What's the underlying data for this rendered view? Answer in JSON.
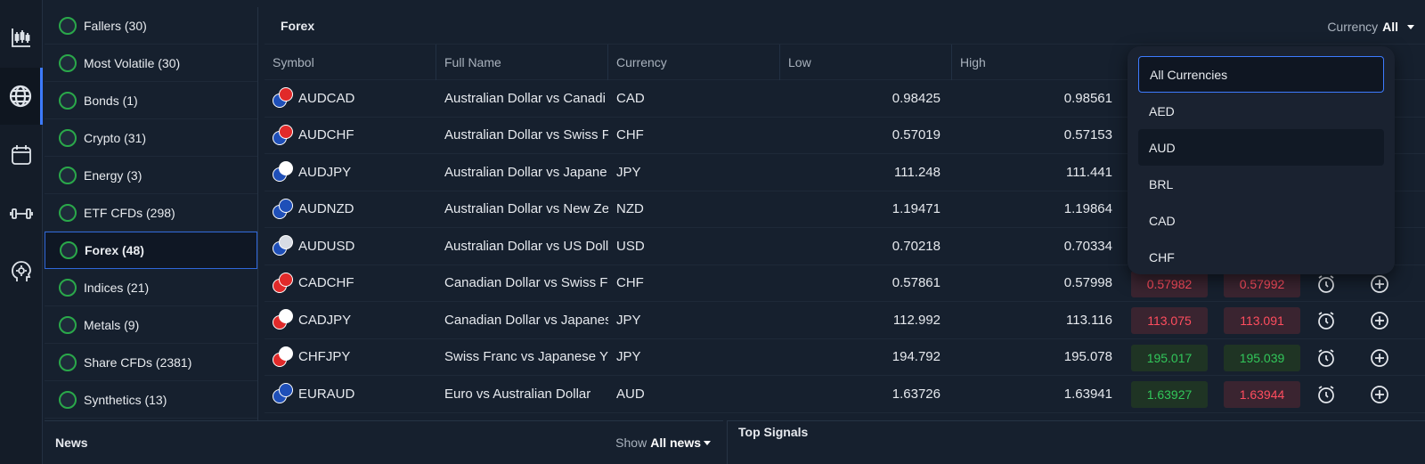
{
  "rail": {
    "items": [
      {
        "icon": "candlestick-chart-icon",
        "active": false
      },
      {
        "icon": "globe-icon",
        "active": true
      },
      {
        "icon": "calendar-icon",
        "active": false
      },
      {
        "icon": "dumbbell-icon",
        "active": false
      },
      {
        "icon": "ai-head-gear-icon",
        "active": false
      }
    ]
  },
  "categories": [
    {
      "label": "Fallers (30)",
      "active": false
    },
    {
      "label": "Most Volatile (30)",
      "active": false
    },
    {
      "label": "Bonds (1)",
      "active": false
    },
    {
      "label": "Crypto (31)",
      "active": false
    },
    {
      "label": "Energy (3)",
      "active": false
    },
    {
      "label": "ETF CFDs (298)",
      "active": false
    },
    {
      "label": "Forex (48)",
      "active": true
    },
    {
      "label": "Indices (21)",
      "active": false
    },
    {
      "label": "Metals (9)",
      "active": false
    },
    {
      "label": "Share CFDs (2381)",
      "active": false
    },
    {
      "label": "Synthetics (13)",
      "active": false
    }
  ],
  "panel": {
    "title": "Forex",
    "currency_label": "Currency",
    "currency_value": "All"
  },
  "columns": [
    "Symbol",
    "Full Name",
    "Currency",
    "Low",
    "High"
  ],
  "rows": [
    {
      "symbol": "AUDCAD",
      "name": "Australian Dollar vs Canadi",
      "currency": "CAD",
      "low": "0.98425",
      "high": "0.98561",
      "flags": [
        "#1f4fb8",
        "#e12a2a"
      ]
    },
    {
      "symbol": "AUDCHF",
      "name": "Australian Dollar vs Swiss F",
      "currency": "CHF",
      "low": "0.57019",
      "high": "0.57153",
      "flags": [
        "#1f4fb8",
        "#e12a2a"
      ]
    },
    {
      "symbol": "AUDJPY",
      "name": "Australian Dollar vs Japane",
      "currency": "JPY",
      "low": "111.248",
      "high": "111.441",
      "flags": [
        "#1f4fb8",
        "#ffffff"
      ]
    },
    {
      "symbol": "AUDNZD",
      "name": "Australian Dollar vs New Ze",
      "currency": "NZD",
      "low": "1.19471",
      "high": "1.19864",
      "flags": [
        "#1f4fb8",
        "#1f4fb8"
      ]
    },
    {
      "symbol": "AUDUSD",
      "name": "Australian Dollar vs US Doll",
      "currency": "USD",
      "low": "0.70218",
      "high": "0.70334",
      "flags": [
        "#1f4fb8",
        "#d8dce4"
      ]
    },
    {
      "symbol": "CADCHF",
      "name": "Canadian Dollar vs Swiss F",
      "currency": "CHF",
      "low": "0.57861",
      "high": "0.57998",
      "flags": [
        "#e12a2a",
        "#e12a2a"
      ],
      "bid": "0.57982",
      "ask": "0.57992",
      "bid_color": "red",
      "ask_color": "red"
    },
    {
      "symbol": "CADJPY",
      "name": "Canadian Dollar vs Japanes",
      "currency": "JPY",
      "low": "112.992",
      "high": "113.116",
      "flags": [
        "#e12a2a",
        "#ffffff"
      ],
      "bid": "113.075",
      "ask": "113.091",
      "bid_color": "red",
      "ask_color": "red"
    },
    {
      "symbol": "CHFJPY",
      "name": "Swiss Franc vs Japanese Y",
      "currency": "JPY",
      "low": "194.792",
      "high": "195.078",
      "flags": [
        "#e12a2a",
        "#ffffff"
      ],
      "bid": "195.017",
      "ask": "195.039",
      "bid_color": "green",
      "ask_color": "green"
    },
    {
      "symbol": "EURAUD",
      "name": "Euro vs Australian Dollar",
      "currency": "AUD",
      "low": "1.63726",
      "high": "1.63941",
      "flags": [
        "#1f4fb8",
        "#1f4fb8"
      ],
      "bid": "1.63927",
      "ask": "1.63944",
      "bid_color": "green",
      "ask_color": "red"
    }
  ],
  "dropdown": {
    "items": [
      "All Currencies",
      "AED",
      "AUD",
      "BRL",
      "CAD",
      "CHF"
    ],
    "selected": "All Currencies",
    "hovered": "AUD"
  },
  "news": {
    "title": "News",
    "show_label": "Show",
    "show_value": "All news"
  },
  "signals": {
    "title": "Top Signals"
  },
  "colors": {
    "accent": "#3d7bff",
    "red": "#ff4d5e",
    "green": "#32c65a",
    "background": "#16202e"
  }
}
